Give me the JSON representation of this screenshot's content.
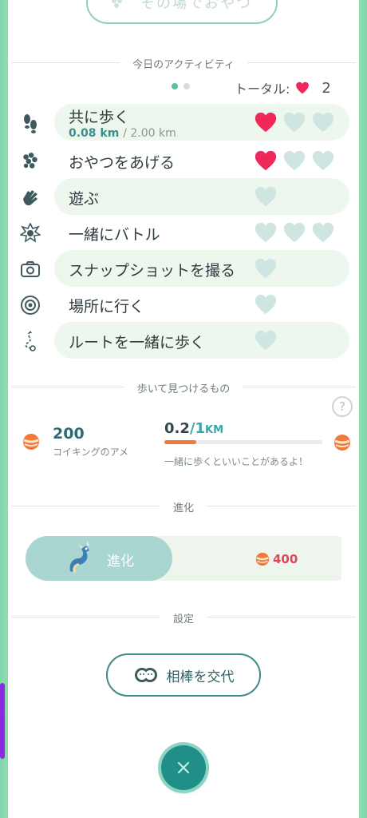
{
  "top_button": {
    "label": "その場でおやつ",
    "icon": "berry-icon"
  },
  "activities": {
    "title": "今日のアクティビティ",
    "total_label": "トータル:",
    "total_value": "2",
    "pager": {
      "pages": 2,
      "current": 1
    },
    "items": [
      {
        "key": "walk",
        "label": "共に歩く",
        "icon": "footprints-icon",
        "distance": "0.08 km",
        "goal": "/ 2.00 km",
        "hearts": [
          "filled",
          "empty",
          "empty"
        ]
      },
      {
        "key": "treat",
        "label": "おやつをあげる",
        "icon": "berry-icon",
        "hearts": [
          "filled",
          "empty",
          "empty"
        ]
      },
      {
        "key": "play",
        "label": "遊ぶ",
        "icon": "wave-hand-icon",
        "hearts": [
          "empty"
        ]
      },
      {
        "key": "battle",
        "label": "一緒にバトル",
        "icon": "battle-icon",
        "hearts": [
          "empty",
          "empty",
          "empty"
        ]
      },
      {
        "key": "snapshot",
        "label": "スナップショットを撮る",
        "icon": "camera-icon",
        "hearts": [
          "empty"
        ]
      },
      {
        "key": "visit",
        "label": "場所に行く",
        "icon": "location-icon",
        "hearts": [
          "empty"
        ]
      },
      {
        "key": "route",
        "label": "ルートを一緒に歩く",
        "icon": "route-icon",
        "hearts": [
          "empty"
        ]
      }
    ]
  },
  "walk_find": {
    "title": "歩いて見つけるもの",
    "help_symbol": "?",
    "candy_count": "200",
    "candy_name": "コイキングのアメ",
    "progress_current": "0.2",
    "progress_goal": "1",
    "progress_unit": "KM",
    "progress_fraction": 0.2,
    "hint": "一緒に歩くといいことがあるよ！"
  },
  "evolve": {
    "title": "進化",
    "button_label": "進化",
    "cost": "400"
  },
  "settings": {
    "title": "設定",
    "swap_label": "相棒を交代"
  },
  "colors": {
    "heart_filled": "#f0285a",
    "heart_empty": "#cfe5e2",
    "accent": "#1f8f87",
    "progress": "#ef7a3a"
  }
}
